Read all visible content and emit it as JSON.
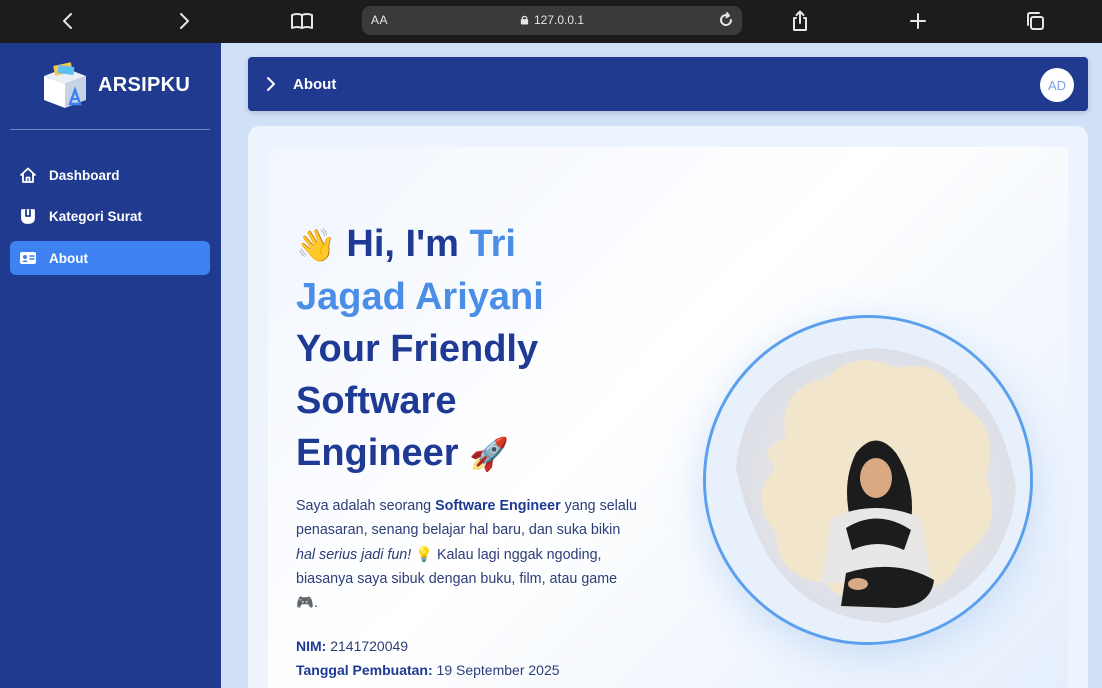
{
  "browser": {
    "text_size_label": "AA",
    "address": "127.0.0.1",
    "icons": [
      "back-icon",
      "forward-icon",
      "reader-icon",
      "lock-icon",
      "reload-icon",
      "share-icon",
      "add-tab-icon",
      "tabs-icon"
    ]
  },
  "sidebar": {
    "brand": "ARSIPKU",
    "items": [
      {
        "label": "Dashboard",
        "icon": "home-icon"
      },
      {
        "label": "Kategori Surat",
        "icon": "category-icon"
      },
      {
        "label": "About",
        "icon": "id-card-icon",
        "active": true
      }
    ]
  },
  "header": {
    "title": "About",
    "avatar_initials": "AD"
  },
  "hero": {
    "wave": "👋",
    "greeting": "Hi, I'm ",
    "name": "Tri Jagad Ariyani",
    "tagline": "Your Friendly Software Engineer",
    "rocket": "🚀",
    "desc_1": "Saya adalah seorang ",
    "desc_bold": "Software Engineer",
    "desc_2": " yang selalu penasaran, senang belajar hal baru, dan suka bikin ",
    "desc_italic": "hal serius jadi fun!",
    "desc_bulb": " 💡 ",
    "desc_3": " Kalau lagi nggak ngoding, biasanya saya sibuk dengan buku, film, atau game ",
    "desc_game": "🎮",
    "desc_end": "."
  },
  "info": {
    "nim_label": "NIM:",
    "nim_value": " 2141720049",
    "date_label": "Tanggal Pembuatan:",
    "date_value": " 19 September 2025"
  },
  "colors": {
    "sidebar": "#1f3a8f",
    "active": "#3d82f0",
    "heading_dark": "#1e3a94",
    "heading_light": "#4a8ee8"
  }
}
